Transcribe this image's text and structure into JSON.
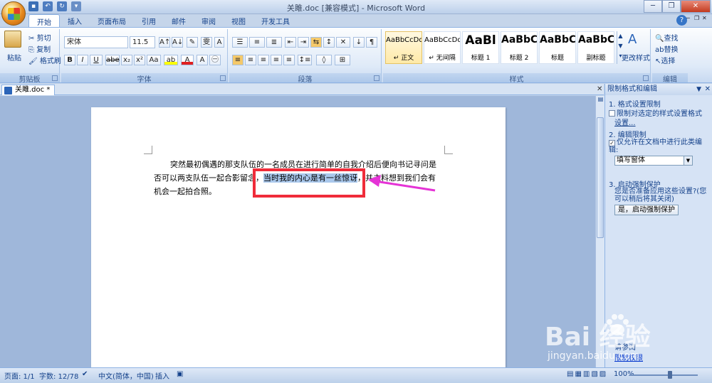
{
  "window": {
    "title": "关雎.doc [兼容模式] - Microsoft Word"
  },
  "tabs": [
    "开始",
    "插入",
    "页面布局",
    "引用",
    "邮件",
    "审阅",
    "视图",
    "开发工具"
  ],
  "active_tab": "开始",
  "clipboard": {
    "paste": "粘贴",
    "cut": "剪切",
    "copy": "复制",
    "format_painter": "格式刷",
    "label": "剪贴板"
  },
  "font": {
    "name": "宋体",
    "size": "11.5",
    "label": "字体"
  },
  "paragraph": {
    "label": "段落"
  },
  "styles": {
    "label": "样式",
    "items": [
      {
        "sample": "AaBbCcDd",
        "name": "↵ 正文"
      },
      {
        "sample": "AaBbCcDd",
        "name": "↵ 无间隔"
      },
      {
        "sample": "AaBl",
        "name": "标题 1"
      },
      {
        "sample": "AaBbC",
        "name": "标题 2"
      },
      {
        "sample": "AaBbC",
        "name": "标题"
      },
      {
        "sample": "AaBbC",
        "name": "副标题"
      }
    ],
    "change_styles": "更改样式"
  },
  "editing": {
    "find": "查找",
    "replace": "替换",
    "select": "选择",
    "label": "编辑"
  },
  "doc_tab": {
    "name": "关雎.doc *"
  },
  "document": {
    "text_before": "突然最初偶遇的那支队伍的一名成员在进行简单的自我介绍后便向书记寻问是否可以两支队伍一起合影留念，",
    "text_highlight": "当时我的内心是有一丝惊讶",
    "text_after": "，并未料想到我们会有机会一起拍合照。"
  },
  "task_pane": {
    "title": "限制格式和编辑",
    "section1": "1. 格式设置限制",
    "check1": "限制对选定的样式设置格式",
    "settings_link": "设置...",
    "section2": "2. 编辑限制",
    "check2": "仅允许在文档中进行此类编辑:",
    "edit_type": "填写窗体",
    "section3": "3. 启动强制保护",
    "question": "您是否准备应用这些设置?(您可以稍后将其关闭)",
    "start_button": "是，启动强制保护",
    "bottom_link1": "请参阅",
    "bottom_link2": "限制权限"
  },
  "status": {
    "page": "页面: 1/1",
    "words": "字数: 12/78",
    "language": "中文(简体，中国)",
    "mode": "插入",
    "zoom": "100%"
  },
  "watermark": {
    "logo": "Bai  经验",
    "url": "jingyan.baidu.com"
  }
}
